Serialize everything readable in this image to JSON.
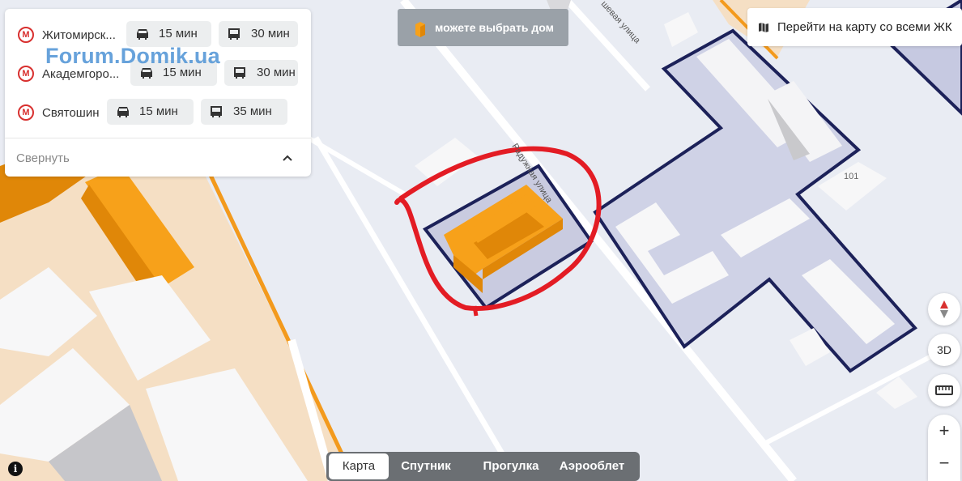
{
  "routes": [
    {
      "station": "Житомирск...",
      "car_time": "15 мин",
      "bus_time": "30 мин"
    },
    {
      "station": "Академгоро...",
      "car_time": "15 мин",
      "bus_time": "30 мин"
    },
    {
      "station": "Святошин",
      "car_time": "15 мин",
      "bus_time": "35 мин"
    }
  ],
  "collapse_label": "Свернуть",
  "watermark": "Forum.Domik.ua",
  "hint": "можете выбрать дом",
  "all_map_link": "Перейти на карту со всеми ЖК",
  "controls": {
    "view3d": "3D",
    "zoom_in": "+",
    "zoom_out": "−"
  },
  "map_modes": [
    "Карта",
    "Спутник",
    "Прогулка",
    "Аэрооблет"
  ],
  "active_mode": "Карта",
  "map_labels": {
    "street_1": "Радужная улица",
    "street_2": "шевая улица",
    "house_number": "101"
  },
  "colors": {
    "highlight_building": "#f7a11a",
    "metro_red": "#d8302f",
    "outline_navy": "#1c2159",
    "annotation_red": "#e31c24"
  },
  "icons": {
    "metro": "metro-m-icon",
    "car": "car-icon",
    "bus": "bus-icon",
    "map": "map-icon",
    "compass": "compass-icon",
    "ruler": "ruler-icon",
    "info": "info-icon",
    "chevron": "chevron-up-icon"
  }
}
